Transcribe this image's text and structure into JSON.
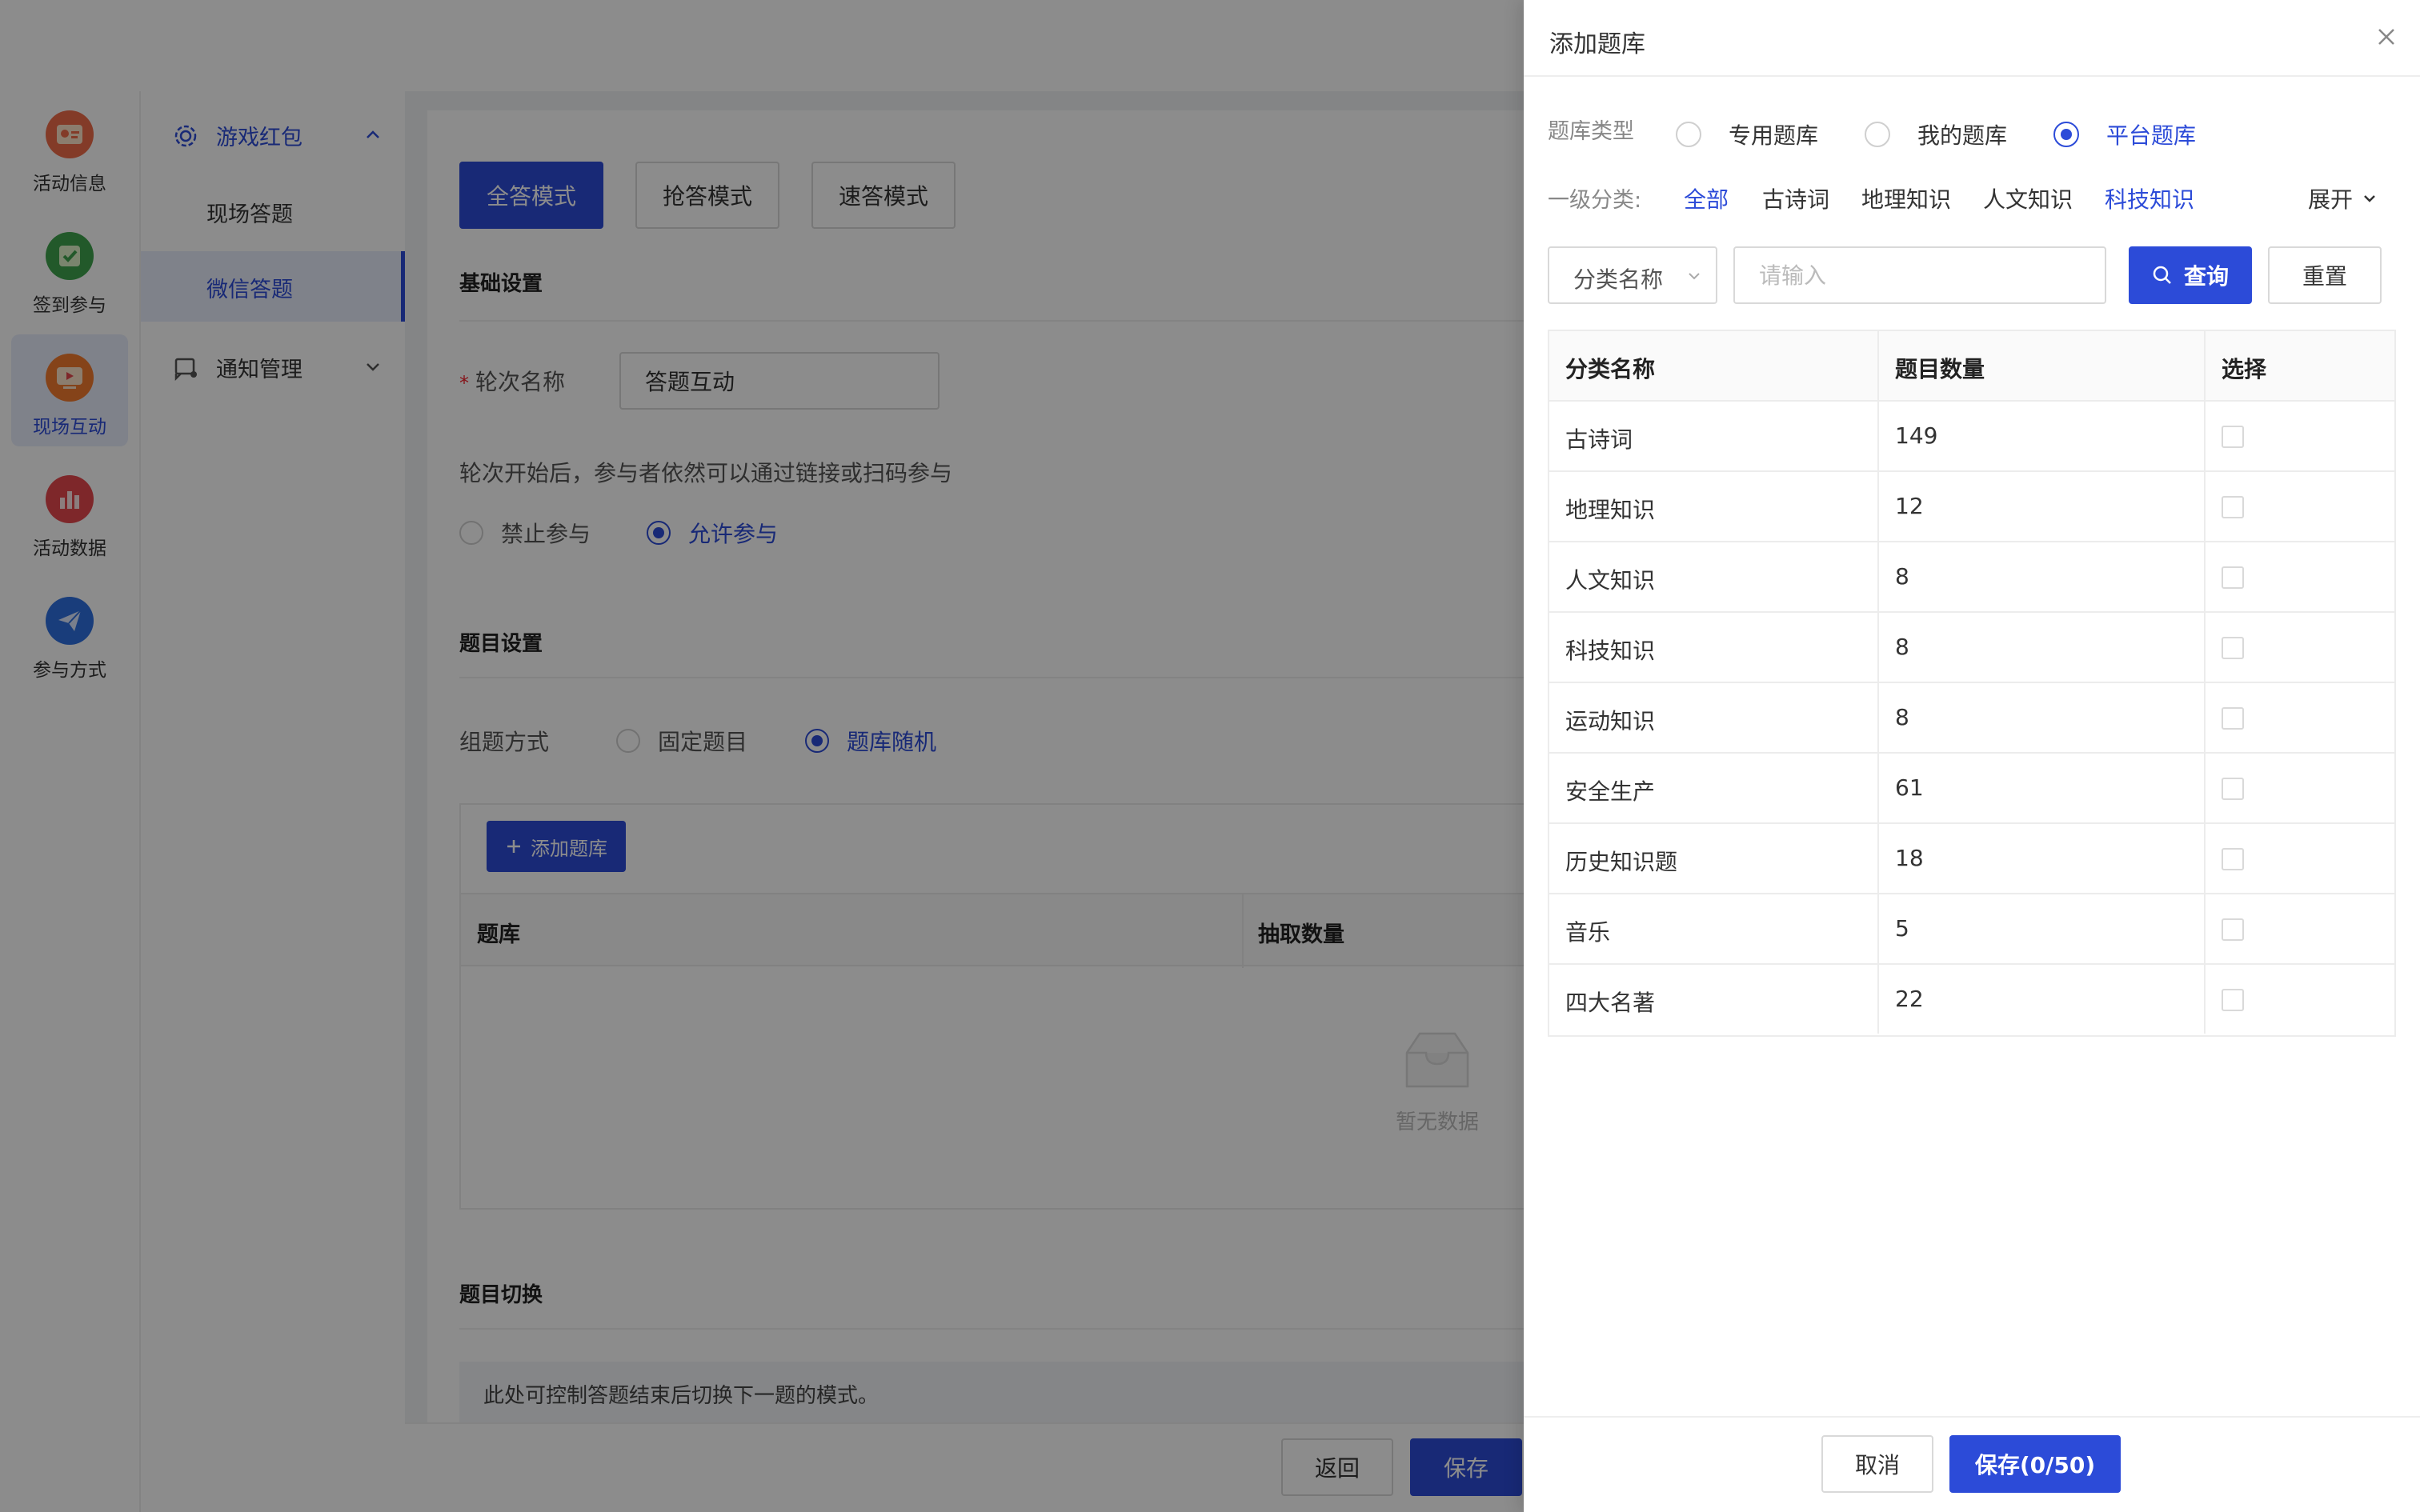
{
  "colors": {
    "accent": "#2c4bd8",
    "overlay": "rgba(0,0,0,0.45)"
  },
  "rail": {
    "items": [
      {
        "label": "活动信息",
        "icon": "activity-info-icon",
        "color": "#ef6c4a"
      },
      {
        "label": "签到参与",
        "icon": "checkin-icon",
        "color": "#3fa34d"
      },
      {
        "label": "现场互动",
        "icon": "live-interaction-icon",
        "color": "#f27a2f"
      },
      {
        "label": "活动数据",
        "icon": "activity-data-icon",
        "color": "#e5484d"
      },
      {
        "label": "参与方式",
        "icon": "participation-icon",
        "color": "#2f6fe0"
      }
    ],
    "active_index": 2
  },
  "menu": {
    "group1": {
      "label": "游戏红包",
      "icon": "gear-icon"
    },
    "sub1": "现场答题",
    "sub2": "微信答题",
    "group2": {
      "label": "通知管理",
      "icon": "notification-icon"
    }
  },
  "main": {
    "modes": [
      "全答模式",
      "抢答模式",
      "速答模式"
    ],
    "active_mode": 0,
    "basic_title": "基础设置",
    "round_label": "轮次名称",
    "round_value": "答题互动",
    "join_text": "轮次开始后，参与者依然可以通过链接或扫码参与",
    "join_options": [
      "禁止参与",
      "允许参与"
    ],
    "join_selected": 1,
    "question_title": "题目设置",
    "compose_label": "组题方式",
    "compose_options": [
      "固定题目",
      "题库随机"
    ],
    "compose_selected": 1,
    "add_bank": "添加题库",
    "bank_columns": [
      "题库",
      "抽取数量"
    ],
    "empty_text": "暂无数据",
    "switch_title": "题目切换",
    "switch_note": "此处可控制答题结束后切换下一题的模式。",
    "back": "返回",
    "save": "保存"
  },
  "drawer": {
    "title": "添加题库",
    "type_label": "题库类型",
    "types": [
      "专用题库",
      "我的题库",
      "平台题库"
    ],
    "type_selected": 2,
    "category_label": "一级分类:",
    "categories": [
      "全部",
      "古诗词",
      "地理知识",
      "人文知识",
      "科技知识"
    ],
    "active_categories": [
      0,
      4
    ],
    "expand": "展开",
    "filter_select": "分类名称",
    "search_placeholder": "请输入",
    "query": "查询",
    "reset": "重置",
    "columns": [
      "分类名称",
      "题目数量",
      "选择"
    ],
    "rows": [
      {
        "name": "古诗词",
        "count": "149"
      },
      {
        "name": "地理知识",
        "count": "12"
      },
      {
        "name": "人文知识",
        "count": "8"
      },
      {
        "name": "科技知识",
        "count": "8"
      },
      {
        "name": "运动知识",
        "count": "8"
      },
      {
        "name": "安全生产",
        "count": "61"
      },
      {
        "name": "历史知识题",
        "count": "18"
      },
      {
        "name": "音乐",
        "count": "5"
      },
      {
        "name": "四大名著",
        "count": "22"
      }
    ],
    "cancel": "取消",
    "save": "保存(0/50)"
  }
}
